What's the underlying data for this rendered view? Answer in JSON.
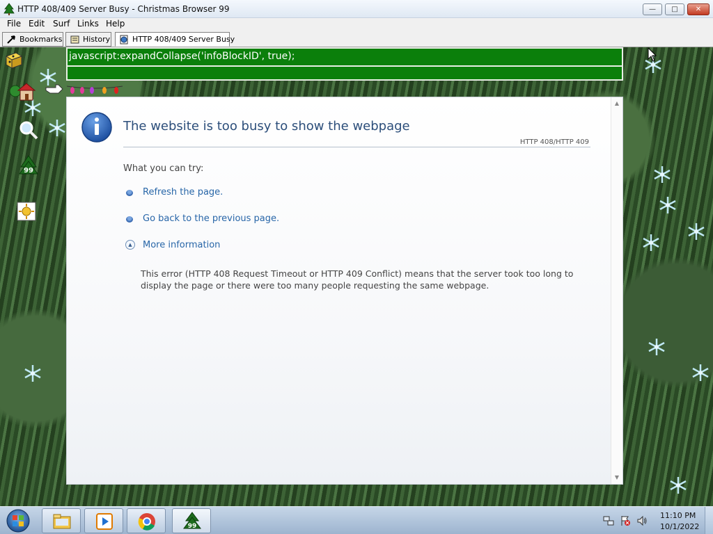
{
  "window": {
    "title": "HTTP 408/409 Server Busy - Christmas Browser 99",
    "icon": "christmas-tree-icon",
    "controls": [
      "minimize",
      "maximize",
      "close"
    ]
  },
  "menu": [
    "File",
    "Edit",
    "Surf",
    "Links",
    "Help"
  ],
  "toolbar": {
    "bookmarks_label": "Bookmarks",
    "history_label": "History",
    "tab_label": "HTTP 408/409 Server Busy"
  },
  "address": {
    "value": "javascript:expandCollapse('infoBlockID', true);",
    "second_line": ""
  },
  "side_icons": [
    "gift-icon",
    "home-icon",
    "search-icon",
    "browser-99-tree-icon",
    "sun-badge-icon"
  ],
  "error": {
    "title": "The website is too busy to show the webpage",
    "code": "HTTP 408/HTTP 409",
    "try_label": "What you can try:",
    "actions": [
      "Refresh the page.",
      "Go back to the previous page."
    ],
    "more_label": "More information",
    "more_text": "This error (HTTP 408 Request Timeout or HTTP 409 Conflict) means that the server took too long to display the page or there were too many people requesting the same webpage."
  },
  "taskbar": {
    "apps": [
      "explorer-icon",
      "media-player-icon",
      "chrome-icon",
      "christmas-browser-99-icon"
    ],
    "clock_time": "11:10 PM",
    "clock_date": "10/1/2022"
  },
  "colors": {
    "address_bg": "#0b7f0b",
    "title_text": "#2c4e7a",
    "link": "#2866a8"
  }
}
